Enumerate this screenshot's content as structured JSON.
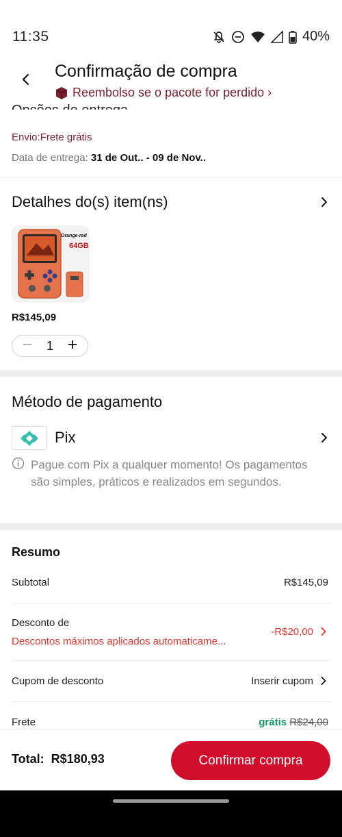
{
  "status_bar": {
    "time": "11:35",
    "battery": "40%",
    "icons": [
      "bell-off-icon",
      "do-not-disturb-icon",
      "wifi-icon",
      "signal-icon",
      "battery-icon"
    ]
  },
  "header": {
    "title": "Confirmação de compra",
    "refund_text": "Reembolso se o pacote for perdido ›"
  },
  "delivery": {
    "heading": "Opções de entrega",
    "shipping_text": "Envio:Frete grátis",
    "date_label": "Data de entrega: ",
    "date_value": "31 de Out.. - 09 de Nov.."
  },
  "items": {
    "title": "Detalhes do(s) item(ns)",
    "product_badge_color": "Orange-red",
    "product_badge_storage": "64GB",
    "price": "R$145,09",
    "quantity": "1"
  },
  "payment": {
    "title": "Método de pagamento",
    "method": "Pix",
    "note": "Pague com Pix a qualquer momento! Os pagamentos são simples, práticos e realizados em segundos."
  },
  "summary": {
    "title": "Resumo",
    "subtotal_label": "Subtotal",
    "subtotal_value": "R$145,09",
    "discount_label": "Desconto de",
    "discount_desc": "Descontos máximos aplicados automaticame...",
    "discount_value": "-R$20,00",
    "coupon_label": "Cupom de desconto",
    "coupon_value": "Inserir cupom",
    "shipping_label": "Frete",
    "shipping_free": "grátis",
    "shipping_original": "R$24,00"
  },
  "footer": {
    "total_label": "Total:",
    "total_value": "R$180,93",
    "confirm_label": "Confirmar compra"
  },
  "colors": {
    "accent": "#d20f2b",
    "discount_red": "#e8352b",
    "free_green": "#0d9b5f",
    "refund_maroon": "#7a1f2e",
    "pix_teal": "#32bcad"
  }
}
